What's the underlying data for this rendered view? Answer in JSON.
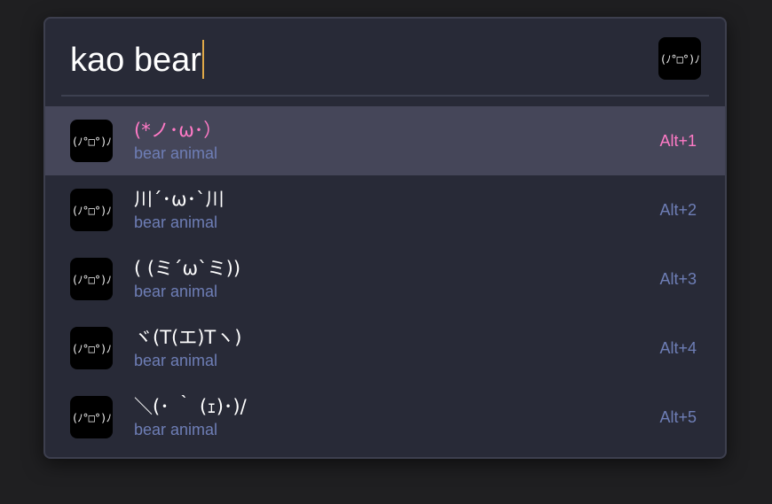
{
  "search": {
    "query": "kao bear"
  },
  "app_icon": {
    "glyph": "(ﾉ°□°)ﾉ"
  },
  "colors": {
    "background": "#1f1f21",
    "panel": "#282a37",
    "selected_row": "#454659",
    "accent_pink": "#ff7ac6",
    "subtitle_blue": "#6e7eb6",
    "caret": "#e0a848"
  },
  "results": [
    {
      "icon": "(ﾉ°□°)ﾉ",
      "title": "(*ノ･ω･）",
      "subtitle": "bear animal",
      "shortcut": "Alt+1",
      "selected": true
    },
    {
      "icon": "(ﾉ°□°)ﾉ",
      "title": "川´･ω･`川",
      "subtitle": "bear animal",
      "shortcut": "Alt+2",
      "selected": false
    },
    {
      "icon": "(ﾉ°□°)ﾉ",
      "title": "( (ミ´ω`ミ))",
      "subtitle": "bear animal",
      "shortcut": "Alt+3",
      "selected": false
    },
    {
      "icon": "(ﾉ°□°)ﾉ",
      "title": "ヾ(T(エ)Tヽ)",
      "subtitle": "bear animal",
      "shortcut": "Alt+4",
      "selected": false
    },
    {
      "icon": "(ﾉ°□°)ﾉ",
      "title": "＼(･ ｀ (ｪ)･)/",
      "subtitle": "bear animal",
      "shortcut": "Alt+5",
      "selected": false
    }
  ]
}
